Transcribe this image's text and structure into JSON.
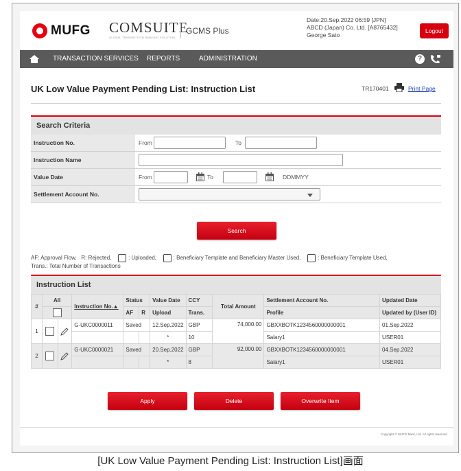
{
  "header": {
    "brand": "MUFG",
    "product": "COMSUITE",
    "product_sub": "GLOBAL TRANSACTION BANKING SOLUTION",
    "app_name": "GCMS Plus",
    "date_line": "Date:20.Sep.2022 06:59 [JPN]",
    "company_line": "ABCD (Japan) Co. Ltd. [A8765432]",
    "user_line": "George Sato",
    "logout_label": "Logout"
  },
  "nav": {
    "items": [
      "TRANSACTION SERVICES",
      "REPORTS",
      "ADMINISTRATION"
    ],
    "help_glyph": "?"
  },
  "page": {
    "title": "UK Low Value Payment Pending List: Instruction List",
    "screen_id": "TR170401",
    "print_label": "Print Page"
  },
  "search": {
    "heading": "Search Criteria",
    "instruction_no_label": "Instruction No.",
    "instruction_name_label": "Instruction Name",
    "value_date_label": "Value Date",
    "settlement_label": "Settlement Account No.",
    "from_label": "From",
    "to_label": "To",
    "date_format": "DDMMYY",
    "search_button": "Search"
  },
  "legend": {
    "af": "AF: Approval Flow,",
    "r": "R: Rejected,",
    "uploaded": ": Uploaded,",
    "beneficiary_master": ": Beneficiary Template and Beneficiary Master Used,",
    "beneficiary_template": ": Beneficiary Template Used,",
    "trans": "Trans.: Total Number of Transactions"
  },
  "list": {
    "heading": "Instruction List",
    "col_hash": "#",
    "col_all": "All",
    "col_instruction": "Instruction No.▲",
    "col_status": "Status",
    "col_af": "AF",
    "col_r": "R",
    "col_value_date": "Value Date",
    "col_upload": "Upload",
    "col_ccy": "CCY",
    "col_trans": "Trans.",
    "col_total": "Total Amount",
    "col_settlement": "Settlement Account No.",
    "col_profile": "Profile",
    "col_updated_date": "Updated Date",
    "col_updated_by": "Updated by (User ID)",
    "rows": [
      {
        "num": "1",
        "instruction": "G-UKC0000011",
        "status": "Saved",
        "value_date": "12.Sep.2022",
        "upload": "*",
        "ccy": "GBP",
        "trans": "10",
        "amount": "74,000.00",
        "account": "GBXXBOTK1234560000000001",
        "profile": "Salary1",
        "updated_date": "01.Sep.2022",
        "updated_by": "USER01"
      },
      {
        "num": "2",
        "instruction": "G-UKC0000021",
        "status": "Saved",
        "value_date": "20.Sep.2022",
        "upload": "*",
        "ccy": "GBP",
        "trans": "8",
        "amount": "92,000.00",
        "account": "GBXXBOTK1234560000000001",
        "profile": "Salary1",
        "updated_date": "04.Sep.2022",
        "updated_by": "USER01"
      }
    ]
  },
  "actions": {
    "apply": "Apply",
    "delete": "Delete",
    "overwrite": "Overwrite Item"
  },
  "footer": {
    "copyright": "Copyright © MUFG Bank, Ltd. All rights reserved."
  },
  "caption": "[UK Low Value Payment Pending List: Instruction List]画面",
  "colors": {
    "brand_red": "#d7000f",
    "nav_bg": "#5a5a5a",
    "link_blue": "#1a3dbf"
  }
}
